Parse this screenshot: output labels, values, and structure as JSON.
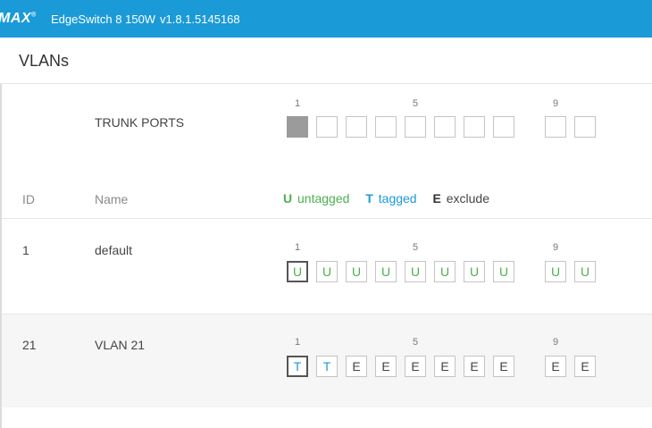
{
  "header": {
    "logo": "MAX",
    "logo_mark": "®",
    "product": "EdgeSwitch 8 150W",
    "version": "v1.8.1.5145168"
  },
  "page": {
    "title": "VLANs"
  },
  "port_numbers": [
    "1",
    "5",
    "9"
  ],
  "trunk": {
    "label": "TRUNK PORTS",
    "ports": [
      true,
      false,
      false,
      false,
      false,
      false,
      false,
      false,
      false,
      false
    ]
  },
  "columns": {
    "id": "ID",
    "name": "Name"
  },
  "legend": {
    "u_key": "U",
    "u_label": "untagged",
    "t_key": "T",
    "t_label": "tagged",
    "e_key": "E",
    "e_label": "exclude"
  },
  "vlans": [
    {
      "id": "1",
      "name": "default",
      "ports": [
        "U",
        "U",
        "U",
        "U",
        "U",
        "U",
        "U",
        "U",
        "U",
        "U"
      ]
    },
    {
      "id": "21",
      "name": "VLAN 21",
      "ports": [
        "T",
        "T",
        "E",
        "E",
        "E",
        "E",
        "E",
        "E",
        "E",
        "E"
      ]
    }
  ],
  "colors": {
    "topbar": "#1b9ad8",
    "untagged": "#4caf50",
    "tagged": "#1b9ad8",
    "exclude": "#444444"
  }
}
